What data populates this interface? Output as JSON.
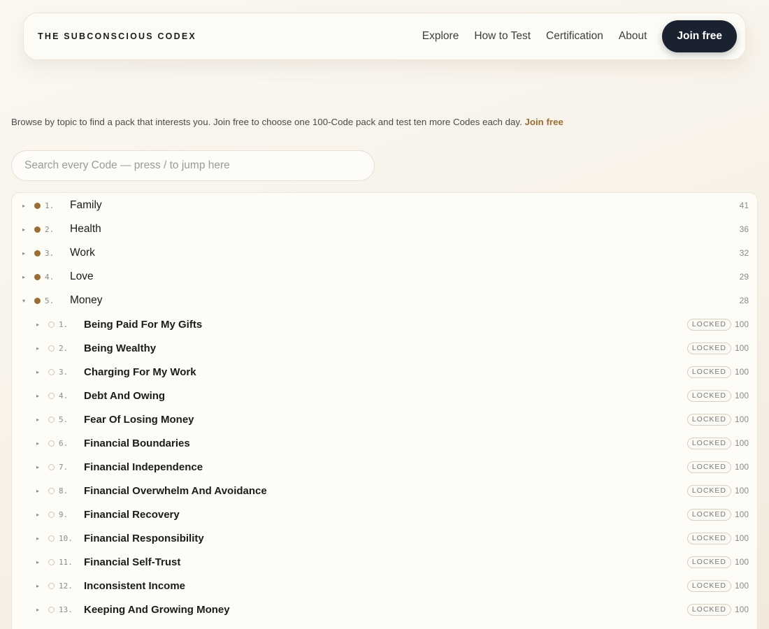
{
  "header": {
    "brand": "THE SUBCONSCIOUS CODEX",
    "nav": [
      "Explore",
      "How to Test",
      "Certification",
      "About"
    ],
    "join_label": "Join free"
  },
  "intro": {
    "text": "Browse by topic to find a pack that interests you. Join free to choose one 100-Code pack and test ten more Codes each day. ",
    "link": "Join free"
  },
  "search": {
    "placeholder": "Search every Code — press / to jump here",
    "value": ""
  },
  "icons": {
    "collapsed": "▸",
    "expanded": "▾",
    "collapsed_name": "caret-right-icon",
    "expanded_name": "caret-down-icon"
  },
  "colors": {
    "accent": "#9a6d35",
    "button_bg": "#1a2230"
  },
  "tree": {
    "topics": [
      {
        "num": "1.",
        "label": "Family",
        "count": "41",
        "expanded": false
      },
      {
        "num": "2.",
        "label": "Health",
        "count": "36",
        "expanded": false
      },
      {
        "num": "3.",
        "label": "Work",
        "count": "32",
        "expanded": false
      },
      {
        "num": "4.",
        "label": "Love",
        "count": "29",
        "expanded": false
      },
      {
        "num": "5.",
        "label": "Money",
        "count": "28",
        "expanded": true,
        "packs": [
          {
            "num": "1.",
            "label": "Being Paid For My Gifts",
            "status": "LOCKED",
            "count": "100"
          },
          {
            "num": "2.",
            "label": "Being Wealthy",
            "status": "LOCKED",
            "count": "100"
          },
          {
            "num": "3.",
            "label": "Charging For My Work",
            "status": "LOCKED",
            "count": "100"
          },
          {
            "num": "4.",
            "label": "Debt And Owing",
            "status": "LOCKED",
            "count": "100"
          },
          {
            "num": "5.",
            "label": "Fear Of Losing Money",
            "status": "LOCKED",
            "count": "100"
          },
          {
            "num": "6.",
            "label": "Financial Boundaries",
            "status": "LOCKED",
            "count": "100"
          },
          {
            "num": "7.",
            "label": "Financial Independence",
            "status": "LOCKED",
            "count": "100"
          },
          {
            "num": "8.",
            "label": "Financial Overwhelm And Avoidance",
            "status": "LOCKED",
            "count": "100"
          },
          {
            "num": "9.",
            "label": "Financial Recovery",
            "status": "LOCKED",
            "count": "100"
          },
          {
            "num": "10.",
            "label": "Financial Responsibility",
            "status": "LOCKED",
            "count": "100"
          },
          {
            "num": "11.",
            "label": "Financial Self-Trust",
            "status": "LOCKED",
            "count": "100"
          },
          {
            "num": "12.",
            "label": "Inconsistent Income",
            "status": "LOCKED",
            "count": "100"
          },
          {
            "num": "13.",
            "label": "Keeping And Growing Money",
            "status": "LOCKED",
            "count": "100"
          }
        ]
      }
    ]
  }
}
